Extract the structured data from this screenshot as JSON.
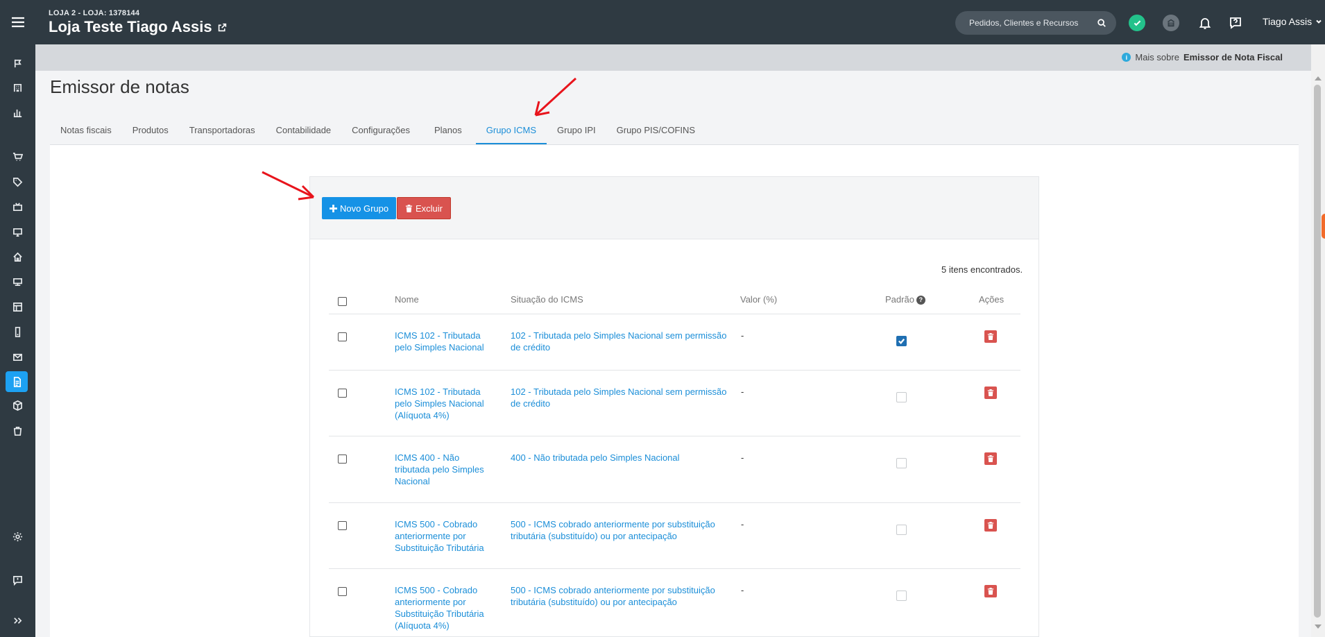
{
  "header": {
    "store_sub": "LOJA 2 - LOJA: 1378144",
    "store_name": "Loja Teste Tiago Assis",
    "search_placeholder": "Pedidos, Clientes e Recursos",
    "user_name": "Tiago Assis"
  },
  "infobar": {
    "prefix": "Mais sobre",
    "link": "Emissor de Nota Fiscal"
  },
  "page": {
    "title": "Emissor de notas"
  },
  "tabs": [
    {
      "label": "Notas fiscais"
    },
    {
      "label": "Produtos"
    },
    {
      "label": "Transportadoras"
    },
    {
      "label": "Contabilidade"
    },
    {
      "label": "Configurações"
    },
    {
      "label": "Planos"
    },
    {
      "label": "Grupo ICMS",
      "active": true
    },
    {
      "label": "Grupo IPI"
    },
    {
      "label": "Grupo PIS/COFINS"
    }
  ],
  "toolbar": {
    "new_label": "Novo Grupo",
    "delete_label": "Excluir"
  },
  "table": {
    "count_text": "5 itens encontrados.",
    "headers": {
      "nome": "Nome",
      "situacao": "Situação do ICMS",
      "valor": "Valor (%)",
      "padrao": "Padrão",
      "acoes": "Ações"
    },
    "rows": [
      {
        "nome": "ICMS 102 - Tributada pelo Simples Nacional",
        "situacao": "102 - Tributada pelo Simples Nacional sem permissão de crédito",
        "valor": "-",
        "padrao": true
      },
      {
        "nome": "ICMS 102 - Tributada pelo Simples Nacional (Alíquota 4%)",
        "situacao": "102 - Tributada pelo Simples Nacional sem permissão de crédito",
        "valor": "-",
        "padrao": false
      },
      {
        "nome": "ICMS 400 - Não tributada pelo Simples Nacional",
        "situacao": "400 - Não tributada pelo Simples Nacional",
        "valor": "-",
        "padrao": false
      },
      {
        "nome": "ICMS 500 - Cobrado anteriormente por Substituição Tributária",
        "situacao": "500 - ICMS cobrado anteriormente por substituição tributária (substituído) ou por antecipação",
        "valor": "-",
        "padrao": false
      },
      {
        "nome": "ICMS 500 - Cobrado anteriormente por Substituição Tributária (Alíquota 4%)",
        "situacao": "500 - ICMS cobrado anteriormente por substituição tributária (substituído) ou por antecipação",
        "valor": "-",
        "padrao": false
      }
    ]
  },
  "colors": {
    "accent": "#1b8ed8",
    "danger": "#d9534f",
    "header_bg": "#2f3a42",
    "annotation": "#e8141c"
  }
}
